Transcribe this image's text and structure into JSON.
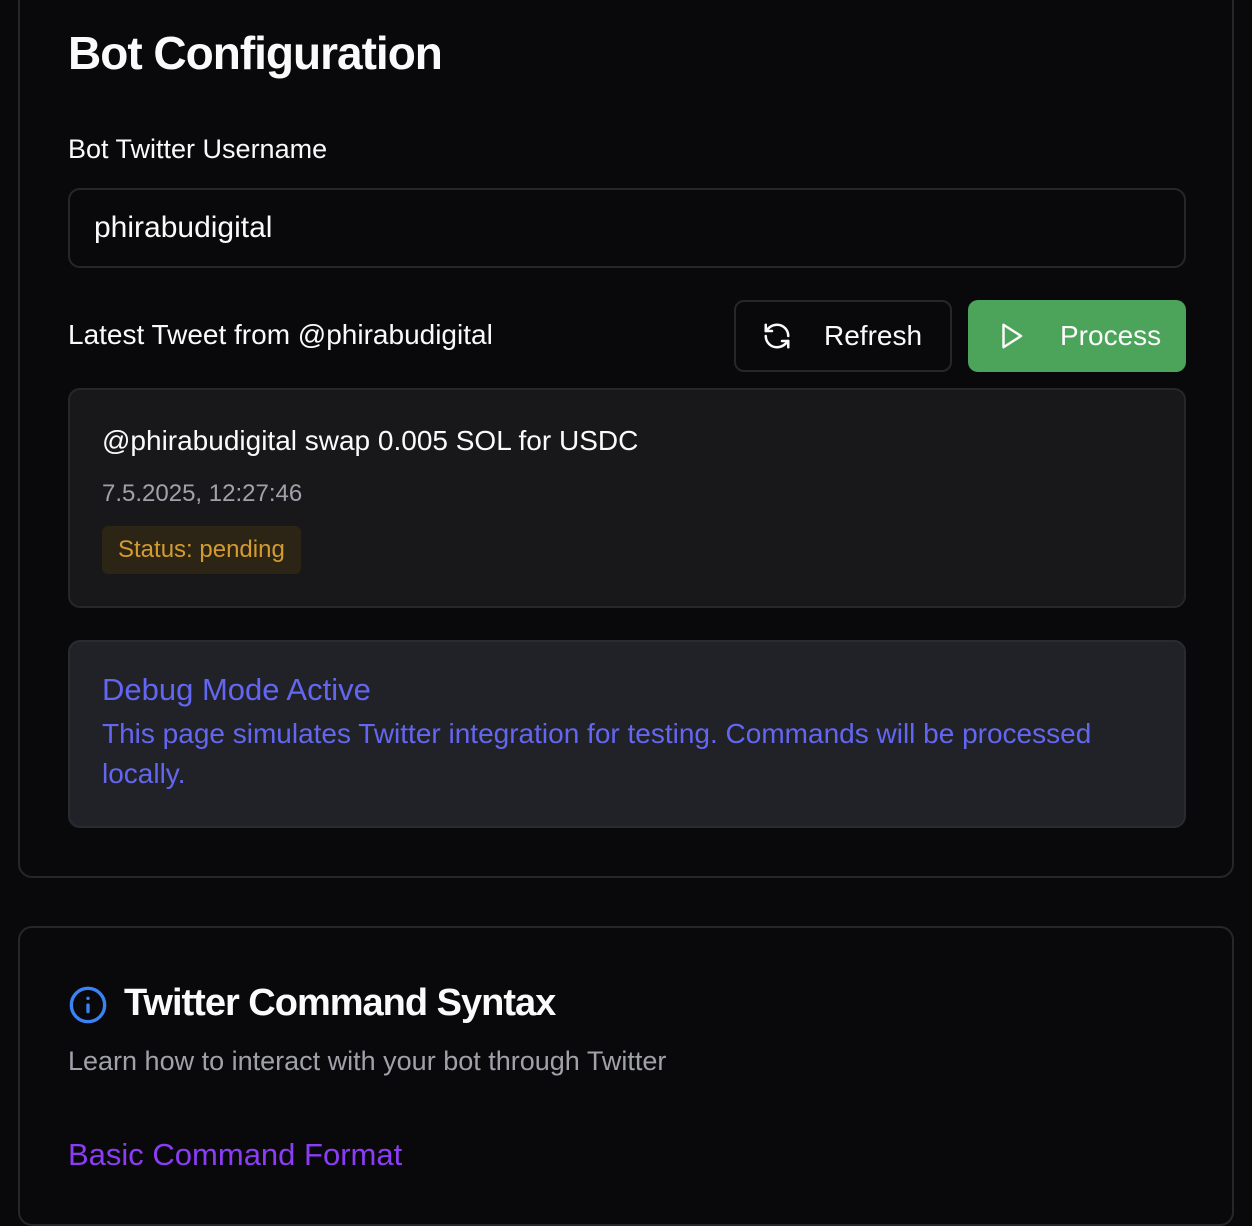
{
  "config": {
    "title": "Bot Configuration",
    "username_label": "Bot Twitter Username",
    "username_value": "phirabudigital",
    "latest_label": "Latest Tweet from @phirabudigital",
    "refresh_label": "Refresh",
    "process_label": "Process"
  },
  "tweet": {
    "text": "@phirabudigital swap 0.005 SOL for USDC",
    "time": "7.5.2025, 12:27:46",
    "status": "Status: pending"
  },
  "debug": {
    "title": "Debug Mode Active",
    "text": "This page simulates Twitter integration for testing. Commands will be processed locally."
  },
  "syntax": {
    "title": "Twitter Command Syntax",
    "subtitle": "Learn how to interact with your bot through Twitter",
    "section_title": "Basic Command Format"
  },
  "colors": {
    "background": "#09090b",
    "process_button": "#4ca35a",
    "status_pending": "#d49b2f",
    "debug_accent": "#6366f1",
    "section_accent": "#8b3df5",
    "info_icon": "#3b82f6"
  },
  "icons": {
    "refresh": "refresh-icon",
    "process": "play-icon",
    "info": "info-icon"
  }
}
